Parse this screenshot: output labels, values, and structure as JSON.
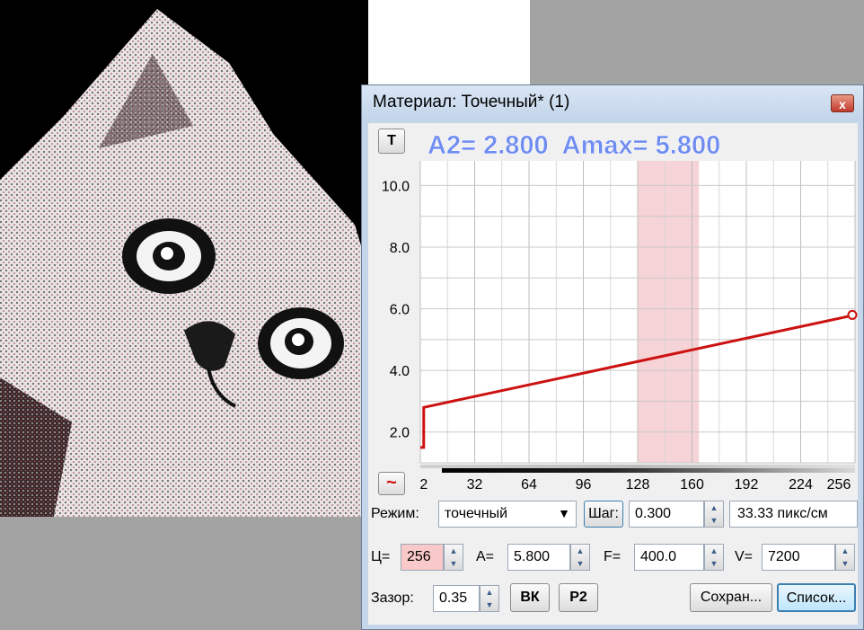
{
  "dialog": {
    "title": "Материал: Точечный* (1)",
    "close_glyph": "x"
  },
  "chart": {
    "t_button": "T",
    "header_text": "A2= 2.800  Amax= 5.800",
    "wave_glyph": "~",
    "y_ticks": [
      "10.0",
      "8.0",
      "6.0",
      "4.0",
      "2.0"
    ],
    "x_ticks": [
      "2",
      "32",
      "64",
      "96",
      "128",
      "160",
      "192",
      "224",
      "256"
    ]
  },
  "chart_data": {
    "type": "line",
    "x": [
      0,
      2,
      2,
      256
    ],
    "y": [
      1.5,
      1.5,
      2.8,
      5.8
    ],
    "xlim": [
      0,
      256
    ],
    "ylim": [
      1,
      10.8
    ],
    "highlight_range": [
      128,
      164
    ],
    "grid": true,
    "colors": {
      "line": "#cc1111",
      "highlight": "#f6d3d6",
      "header": "#6f8cf1"
    }
  },
  "controls": {
    "mode_label": "Режим:",
    "mode_value": "точечный",
    "step_button": "Шаг:",
    "step_value": "0.300",
    "density": "33.33 пикс/см",
    "c_label": "Ц=",
    "c_value": "256",
    "a_label": "A=",
    "a_value": "5.800",
    "f_label": "F=",
    "f_value": "400.0",
    "v_label": "V=",
    "v_value": "7200",
    "gap_label": "Зазор:",
    "gap_value": "0.35",
    "vk_button": "ВК",
    "p2_button": "P2",
    "save_button": "Сохран...",
    "list_button": "Список..."
  }
}
